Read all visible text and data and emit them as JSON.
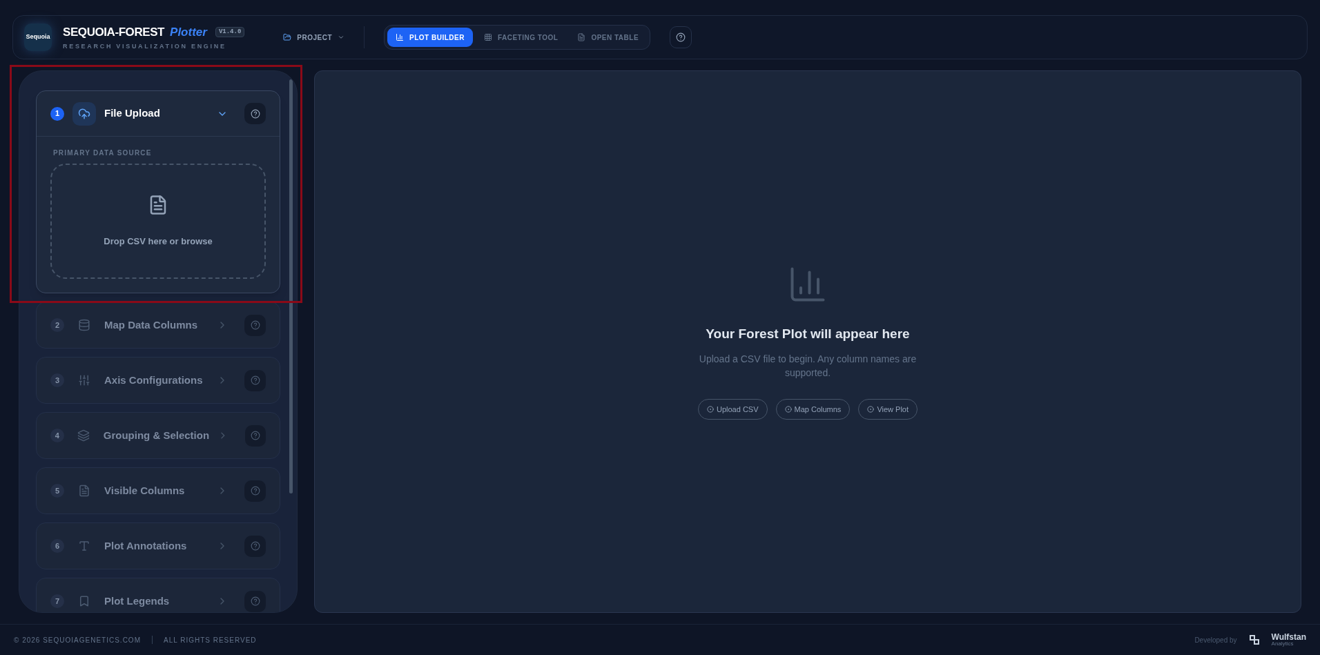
{
  "header": {
    "logo_text": "Sequoia",
    "title": "SEQUOIA-FOREST",
    "title_accent": "Plotter",
    "version": "V1.4.0",
    "subtitle": "RESEARCH VISUALIZATION ENGINE",
    "project_menu": "PROJECT",
    "tabs": [
      {
        "label": "PLOT BUILDER",
        "selected": true
      },
      {
        "label": "FACETING TOOL",
        "selected": false
      },
      {
        "label": "OPEN TABLE",
        "selected": false
      }
    ]
  },
  "steps": [
    {
      "number": "1",
      "title": "File Upload",
      "expanded": true,
      "disabled": false,
      "section_label": "PRIMARY DATA SOURCE",
      "drop_text": "Drop CSV here or browse"
    },
    {
      "number": "2",
      "title": "Map Data Columns",
      "expanded": false,
      "disabled": true
    },
    {
      "number": "3",
      "title": "Axis Configurations",
      "expanded": false,
      "disabled": true
    },
    {
      "number": "4",
      "title": "Grouping & Selection",
      "expanded": false,
      "disabled": true
    },
    {
      "number": "5",
      "title": "Visible Columns",
      "expanded": false,
      "disabled": true
    },
    {
      "number": "6",
      "title": "Plot Annotations",
      "expanded": false,
      "disabled": true
    },
    {
      "number": "7",
      "title": "Plot Legends",
      "expanded": false,
      "disabled": true
    }
  ],
  "empty_state": {
    "title": "Your Forest Plot will appear here",
    "message": "Upload a CSV file to begin. Any column names are supported.",
    "buttons": [
      "Upload CSV",
      "Map Columns",
      "View Plot"
    ]
  },
  "footer": {
    "copyright": "© 2026 SEQUOIAGENETICS.COM",
    "rights": "ALL RIGHTS RESERVED",
    "developed_by": "Developed by",
    "brand": "Wulfstan",
    "brand_sub": "Analytics"
  }
}
